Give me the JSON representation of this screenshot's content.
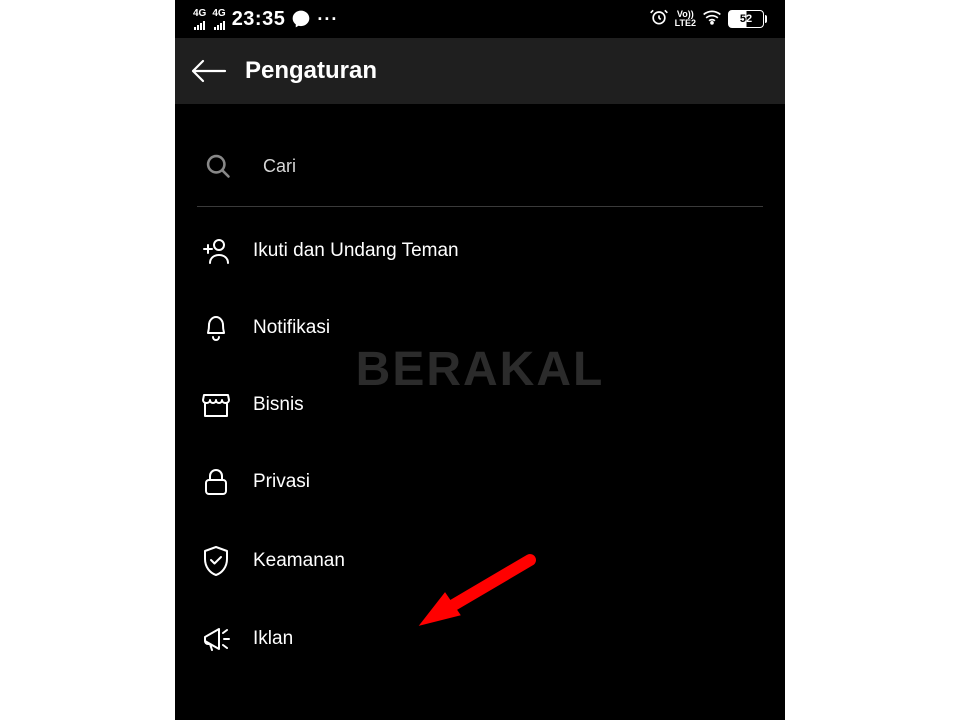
{
  "statusbar": {
    "net1": "4G",
    "net2": "4G",
    "time": "23:35",
    "lte_top": "Vo))",
    "lte_bottom": "LTE2",
    "battery": "52"
  },
  "header": {
    "title": "Pengaturan"
  },
  "search": {
    "placeholder": "Cari"
  },
  "menu": [
    {
      "icon": "add-person-icon",
      "label": "Ikuti dan Undang Teman"
    },
    {
      "icon": "bell-icon",
      "label": "Notifikasi"
    },
    {
      "icon": "shop-icon",
      "label": "Bisnis"
    },
    {
      "icon": "lock-icon",
      "label": "Privasi"
    },
    {
      "icon": "shield-icon",
      "label": "Keamanan"
    },
    {
      "icon": "megaphone-icon",
      "label": "Iklan"
    }
  ],
  "watermark": "BERAKAL"
}
